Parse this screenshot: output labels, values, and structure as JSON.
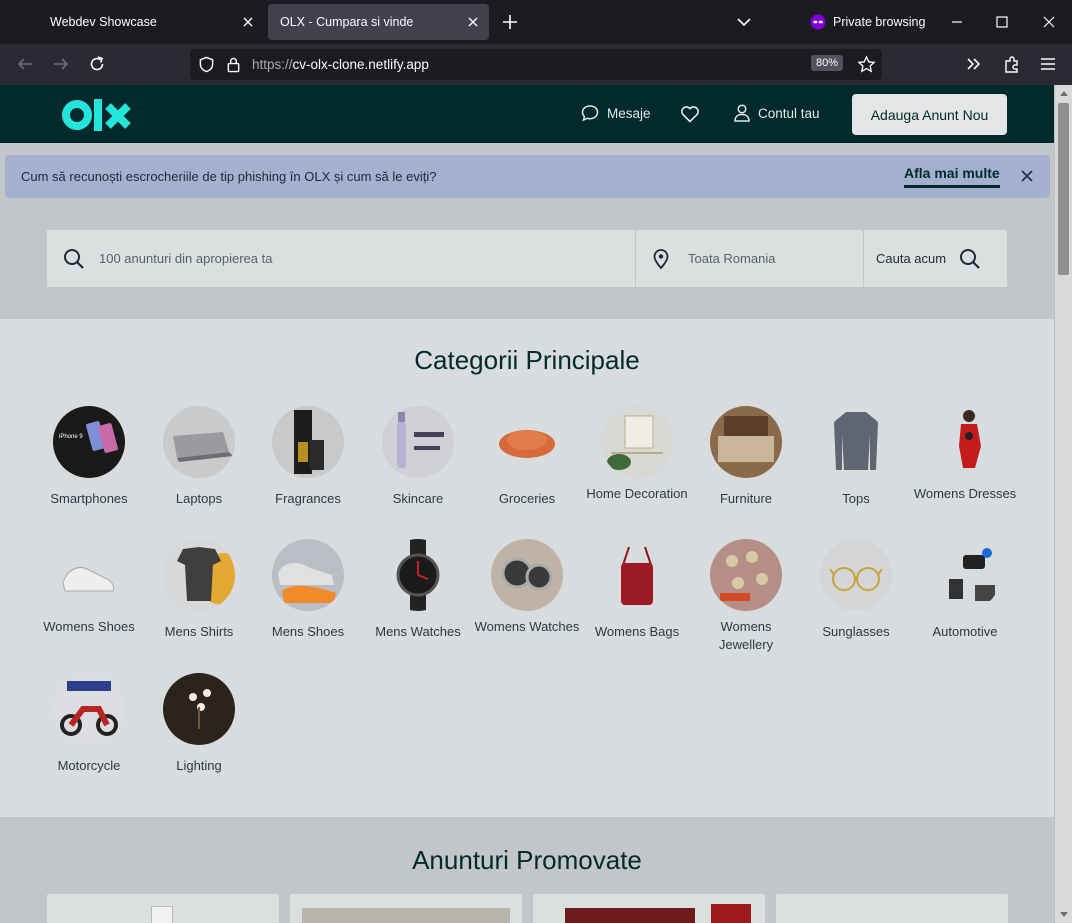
{
  "browser": {
    "tabs": [
      {
        "label": "Webdev Showcase"
      },
      {
        "label": "OLX - Cumpara si vinde"
      }
    ],
    "private_label": "Private browsing",
    "url_scheme": "https://",
    "url_host": "cv-olx-clone.netlify.app",
    "zoom": "80%"
  },
  "header": {
    "messages": "Mesaje",
    "account": "Contul tau",
    "post_button": "Adauga Anunt Nou"
  },
  "banner": {
    "text": "Cum să recunoști escrocheriile de tip phishing în OLX și cum să le eviți?",
    "link": "Afla mai multe"
  },
  "search": {
    "placeholder": "100 anunturi din apropierea ta",
    "location": "Toata Romania",
    "button": "Cauta acum"
  },
  "categories": {
    "title": "Categorii Principale",
    "items": [
      {
        "label": "Smartphones"
      },
      {
        "label": "Laptops"
      },
      {
        "label": "Fragrances"
      },
      {
        "label": "Skincare"
      },
      {
        "label": "Groceries"
      },
      {
        "label": "Home Decoration"
      },
      {
        "label": "Furniture"
      },
      {
        "label": "Tops"
      },
      {
        "label": "Womens Dresses"
      },
      {
        "label": "Womens Shoes"
      },
      {
        "label": "Mens Shirts"
      },
      {
        "label": "Mens Shoes"
      },
      {
        "label": "Mens Watches"
      },
      {
        "label": "Womens Watches"
      },
      {
        "label": "Womens Bags"
      },
      {
        "label": "Womens Jewellery"
      },
      {
        "label": "Sunglasses"
      },
      {
        "label": "Automotive"
      },
      {
        "label": "Motorcycle"
      },
      {
        "label": "Lighting"
      }
    ]
  },
  "promoted": {
    "title": "Anunturi Promovate"
  },
  "colors": {
    "header_bg": "#002a2c",
    "logo": "#23e5db",
    "banner_bg": "#a4b0cf"
  }
}
